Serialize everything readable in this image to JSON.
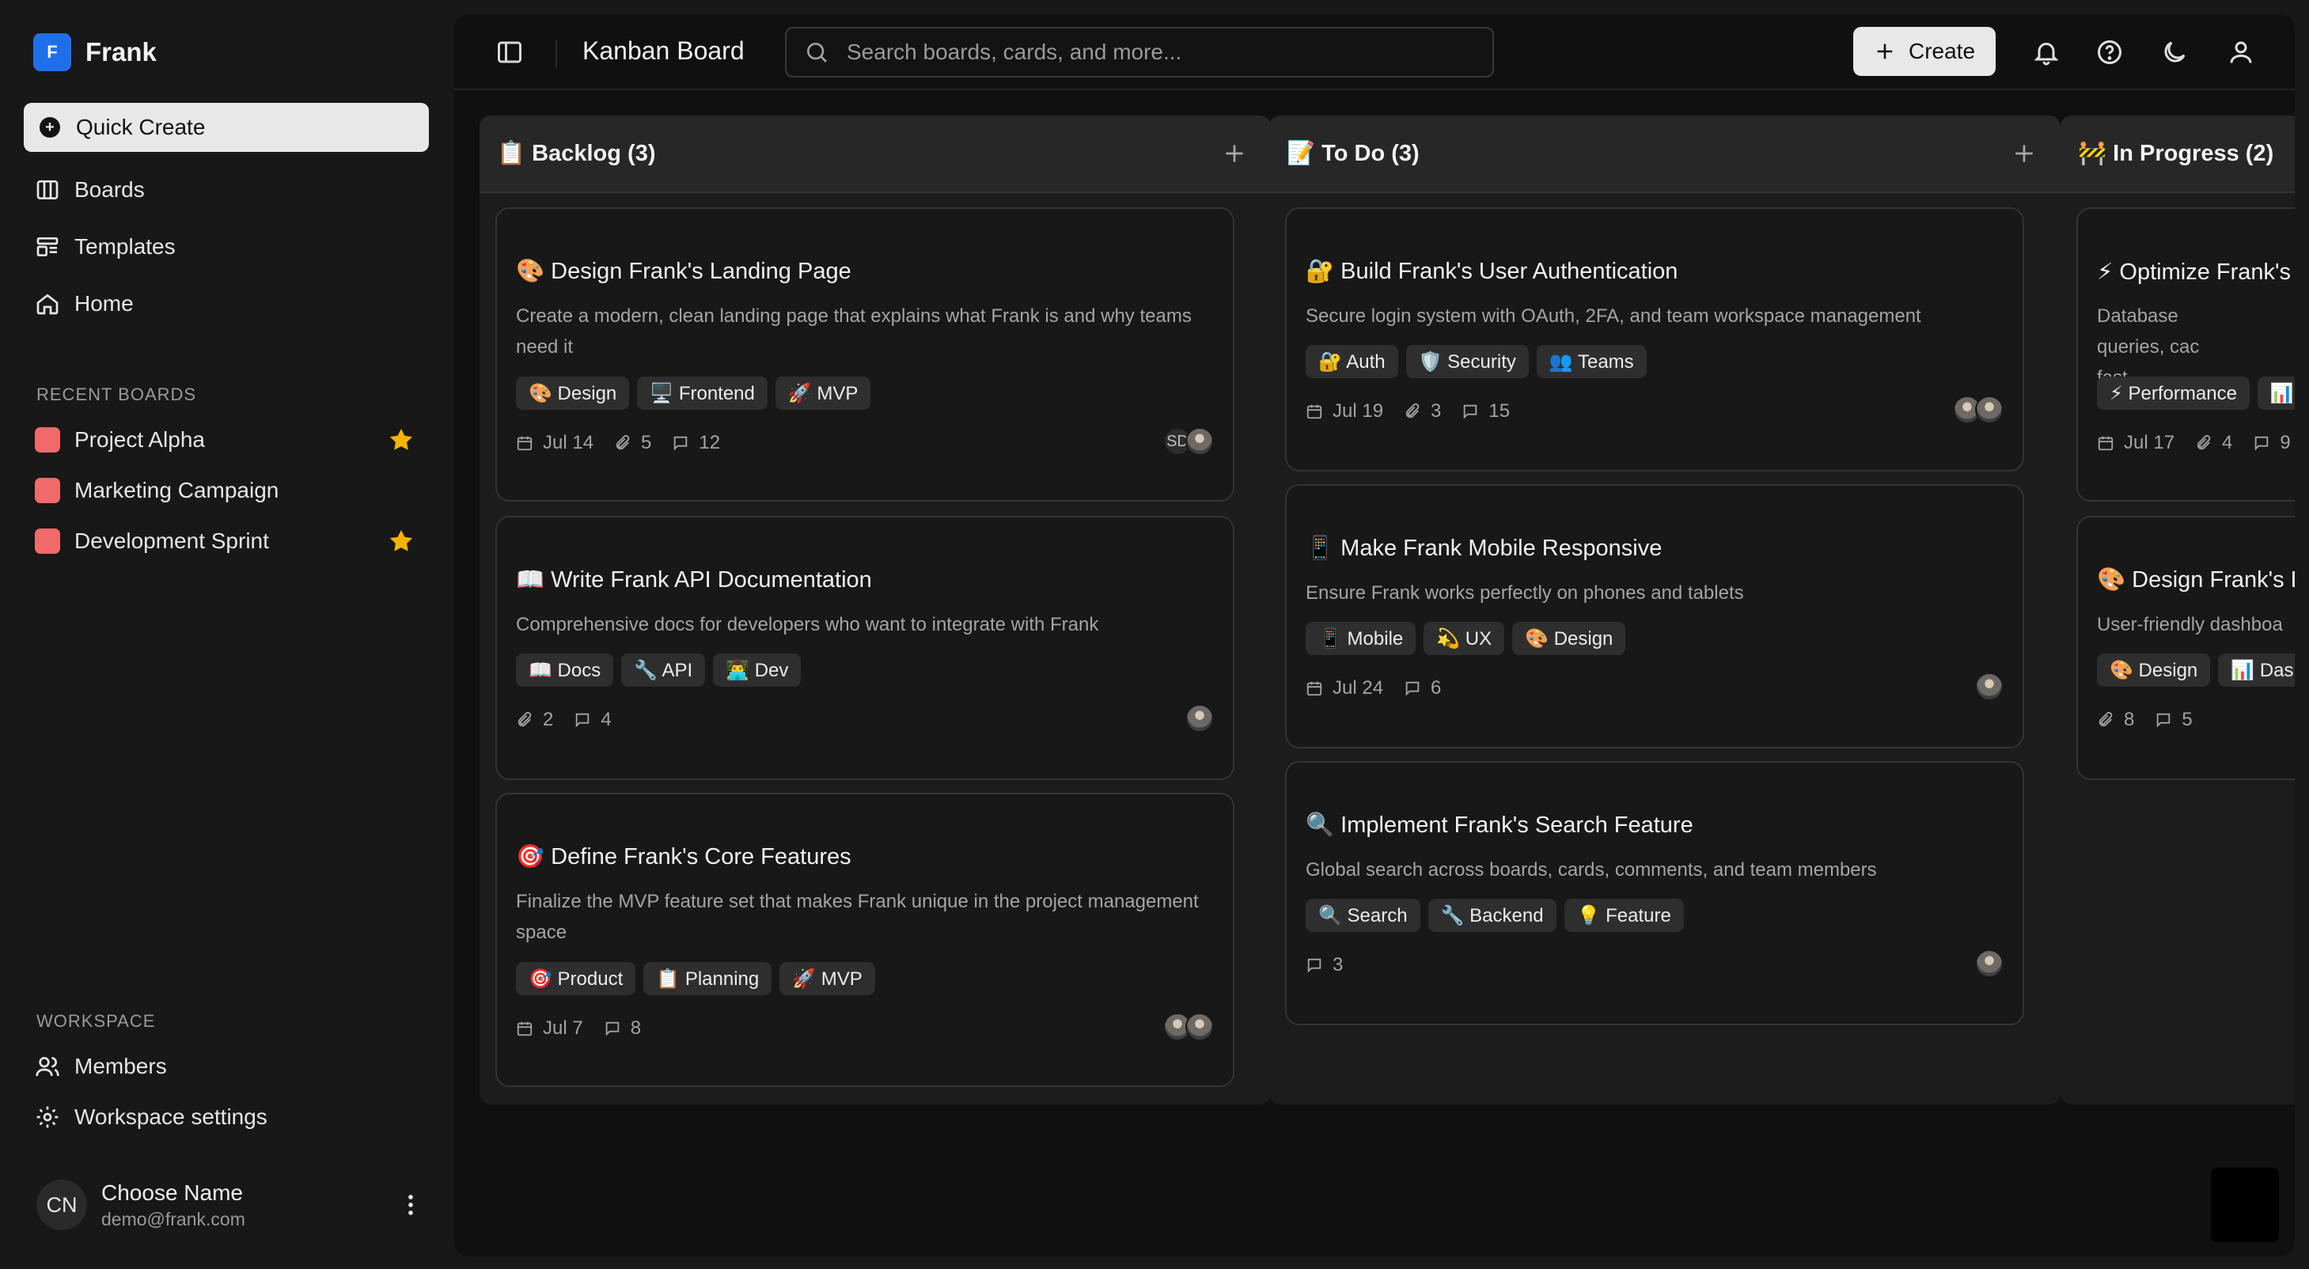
{
  "brand": {
    "logo_letter": "F",
    "name": "Frank",
    "accent": "#1f6feb"
  },
  "sidebar": {
    "quick_create": "Quick Create",
    "nav": [
      "Boards",
      "Templates",
      "Home"
    ],
    "recent_label": "RECENT BOARDS",
    "recent": [
      {
        "name": "Project Alpha",
        "starred": true
      },
      {
        "name": "Marketing Campaign",
        "starred": false
      },
      {
        "name": "Development Sprint",
        "starred": true
      }
    ],
    "workspace_label": "WORKSPACE",
    "workspace": [
      "Members",
      "Workspace settings"
    ],
    "user": {
      "initials": "CN",
      "name": "Choose Name",
      "email": "demo@frank.com"
    }
  },
  "topbar": {
    "title": "Kanban Board",
    "search_placeholder": "Search boards, cards, and more...",
    "create_label": "Create"
  },
  "columns": [
    {
      "title": "📋 Backlog (3)",
      "cards": [
        {
          "title": "🎨 Design Frank's Landing Page",
          "desc": "Create a modern, clean landing page that explains what Frank is and why teams need it",
          "tags": [
            "🎨 Design",
            "🖥️ Frontend",
            "🚀 MVP"
          ],
          "date": "Jul 14",
          "attachments": "5",
          "comments": "12",
          "avatars": [
            "SD",
            "photo"
          ]
        },
        {
          "title": "📖 Write Frank API Documentation",
          "desc": "Comprehensive docs for developers who want to integrate with Frank",
          "tags": [
            "📖 Docs",
            "🔧 API",
            "👨‍💻 Dev"
          ],
          "attachments": "2",
          "comments": "4",
          "avatars": [
            "photo"
          ]
        },
        {
          "title": "🎯 Define Frank's Core Features",
          "desc": "Finalize the MVP feature set that makes Frank unique in the project management space",
          "tags": [
            "🎯 Product",
            "📋 Planning",
            "🚀 MVP"
          ],
          "date": "Jul 7",
          "comments": "8",
          "avatars": [
            "photo",
            "photo"
          ]
        }
      ]
    },
    {
      "title": "📝 To Do (3)",
      "cards": [
        {
          "title": "🔐 Build Frank's User Authentication",
          "desc": "Secure login system with OAuth, 2FA, and team workspace management",
          "tags": [
            "🔐 Auth",
            "🛡️ Security",
            "👥 Teams"
          ],
          "date": "Jul 19",
          "attachments": "3",
          "comments": "15",
          "avatars": [
            "photo",
            "photo"
          ]
        },
        {
          "title": "📱 Make Frank Mobile Responsive",
          "desc": "Ensure Frank works perfectly on phones and tablets",
          "tags": [
            "📱 Mobile",
            "💫 UX",
            "🎨 Design"
          ],
          "date": "Jul 24",
          "comments": "6",
          "avatars": [
            "photo"
          ]
        },
        {
          "title": "🔍 Implement Frank's Search Feature",
          "desc": "Global search across boards, cards, comments, and team members",
          "tags": [
            "🔍 Search",
            "🔧 Backend",
            "💡 Feature"
          ],
          "comments": "3",
          "avatars": [
            "photo"
          ]
        }
      ]
    },
    {
      "title": "🚧 In Progress (2)",
      "cards": [
        {
          "title": "⚡ Optimize Frank's",
          "desc": "Database queries, cac fast",
          "tags": [
            "⚡ Performance",
            "📊"
          ],
          "date": "Jul 17",
          "attachments": "4",
          "comments": "9",
          "avatars": []
        },
        {
          "title": "🎨 Design Frank's D",
          "desc": "User-friendly dashboa",
          "tags": [
            "🎨 Design",
            "📊 Dash"
          ],
          "attachments": "8",
          "comments": "5",
          "avatars": []
        }
      ]
    }
  ]
}
